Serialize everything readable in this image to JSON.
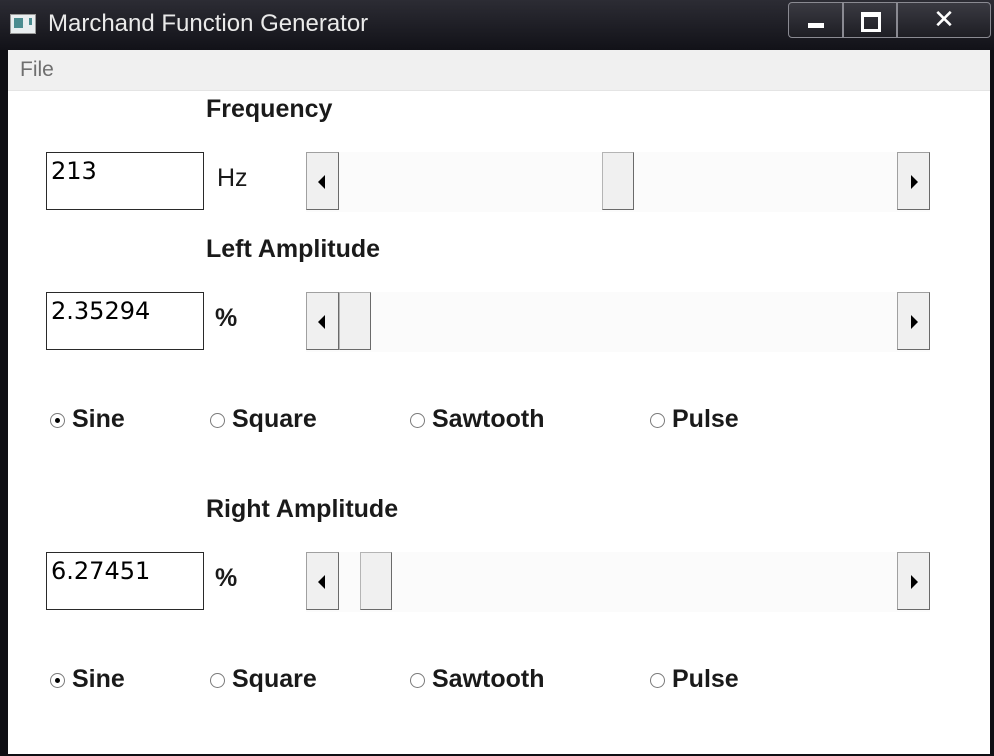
{
  "window": {
    "title": "Marchand Function Generator",
    "close_glyph": "✕"
  },
  "menu": {
    "items": [
      "File"
    ]
  },
  "frequency": {
    "label": "Frequency",
    "value": "213",
    "unit": "Hz",
    "slider_position": 0.5
  },
  "left_amplitude": {
    "label": "Left Amplitude",
    "value": "2.35294",
    "unit": "%",
    "slider_position": 0.0,
    "waveforms": [
      {
        "label": "Sine",
        "checked": true
      },
      {
        "label": "Square",
        "checked": false
      },
      {
        "label": "Sawtooth",
        "checked": false
      },
      {
        "label": "Pulse",
        "checked": false
      }
    ]
  },
  "right_amplitude": {
    "label": "Right Amplitude",
    "value": "6.27451",
    "unit": "%",
    "slider_position": 0.04,
    "waveforms": [
      {
        "label": "Sine",
        "checked": true
      },
      {
        "label": "Square",
        "checked": false
      },
      {
        "label": "Sawtooth",
        "checked": false
      },
      {
        "label": "Pulse",
        "checked": false
      }
    ]
  }
}
